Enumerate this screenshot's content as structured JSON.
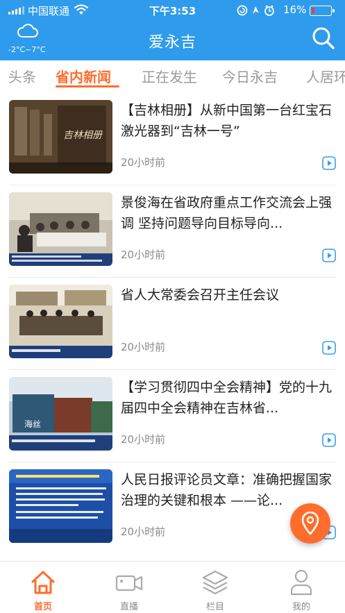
{
  "status_bar": {
    "carrier": "中国联通",
    "time": "下午3:53",
    "battery": "16%",
    "battery_level": 0.16
  },
  "header": {
    "weather_temp": "-2°C~7°C",
    "title": "爱永吉",
    "accent": "#2f9bec"
  },
  "tabs": [
    {
      "label": "头条",
      "active": false
    },
    {
      "label": "省内新闻",
      "active": true
    },
    {
      "label": "正在发生",
      "active": false
    },
    {
      "label": "今日永吉",
      "active": false
    },
    {
      "label": "人居环",
      "active": false
    }
  ],
  "news": [
    {
      "title": "【吉林相册】从新中国第一台红宝石激光器到“吉林一号”",
      "time": "20小时前",
      "thumb_caption": "吉林相册"
    },
    {
      "title": "景俊海在省政府重点工作交流会上强调 坚持问题导向目标导向...",
      "time": "20小时前",
      "thumb_caption": ""
    },
    {
      "title": "省人大常委会召开主任会议",
      "time": "20小时前",
      "thumb_caption": ""
    },
    {
      "title": "【学习贯彻四中全会精神】党的十九届四中全会精神在吉林省...",
      "time": "20小时前",
      "thumb_caption": ""
    },
    {
      "title": "人民日报评论员文章：准确把握国家治理的关键和根本 ——论...",
      "time": "20小时前",
      "thumb_caption": ""
    }
  ],
  "bottom_nav": [
    {
      "label": "首页",
      "icon": "home-icon",
      "active": true
    },
    {
      "label": "直播",
      "icon": "video-camera-icon",
      "active": false
    },
    {
      "label": "栏目",
      "icon": "layers-icon",
      "active": false
    },
    {
      "label": "我的",
      "icon": "user-icon",
      "active": false
    }
  ],
  "colors": {
    "accent_orange": "#ff6d2c",
    "header_blue": "#2f9bec"
  }
}
